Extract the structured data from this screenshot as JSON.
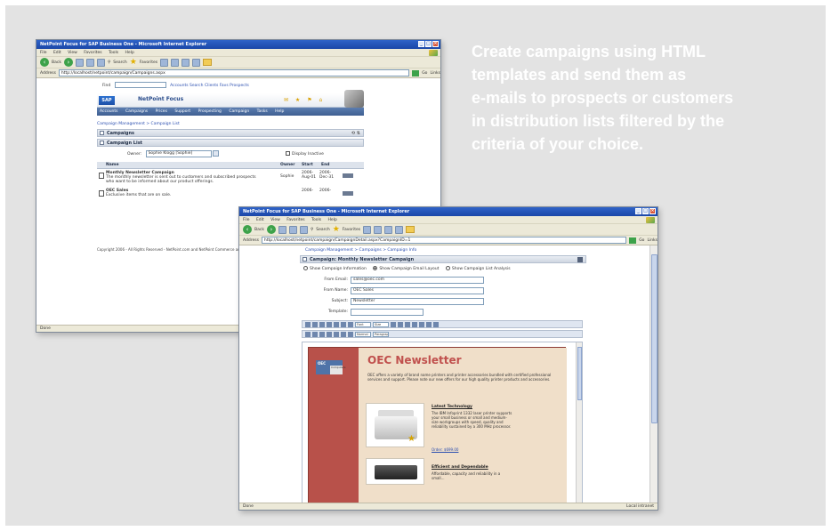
{
  "caption": {
    "lines": [
      "Create campaigns using HTML",
      "templates and send them as",
      "e-mails to prospects or customers",
      "in distribution lists filtered by the",
      "criteria of your choice."
    ]
  },
  "window1": {
    "title": "NetPoint Focus for SAP Business One - Microsoft Internet Explorer",
    "menu": [
      "File",
      "Edit",
      "View",
      "Favorites",
      "Tools",
      "Help"
    ],
    "toolbar": {
      "back": "Back",
      "search": "Search",
      "favorites": "Favorites"
    },
    "address_label": "Address",
    "address": "http://localhost/netpoint/campaign/Campaigns.aspx",
    "go": "Go",
    "links": "Links",
    "search_label": "Find",
    "search_links": "Accounts  Search  Clients  Favs  Prospects",
    "app_name": "NetPoint Focus",
    "nav": [
      "Accounts",
      "Campaigns",
      "Prices",
      "Support",
      "Prospecting",
      "Campaign",
      "Tasks",
      "Help"
    ],
    "breadcrumb": "Campaign Management > Campaign List",
    "section_campaigns": "Campaigns",
    "section_list": "Campaign List",
    "owner_label": "Owner:",
    "owner_value": "Sophie Klogg [Sophie]",
    "display_inactive": "Display Inactive",
    "columns": [
      "Name",
      "Owner",
      "Start",
      "End"
    ],
    "rows": [
      {
        "name": "Monthly Newsletter Campaign",
        "desc": "The monthly newsletter is sent out to customers and subscribed prospects who want to be informed about our product offerings.",
        "owner": "Sophie",
        "start": "2006-Aug-01",
        "end": "2006-Dec-31"
      },
      {
        "name": "OEC Sales",
        "desc": "Exclusive items that are on sale.",
        "owner": "",
        "start": "2006-",
        "end": "2006-"
      }
    ],
    "copyright": "Copyright 2006 - All Rights Reserved - NetPoint.com and NetPoint Commerce and are trademarks",
    "status": "Done",
    "zone": "Local intranet"
  },
  "window2": {
    "title": "NetPoint Focus for SAP Business One - Microsoft Internet Explorer",
    "menu": [
      "File",
      "Edit",
      "View",
      "Favorites",
      "Tools",
      "Help"
    ],
    "toolbar": {
      "back": "Back",
      "search": "Search",
      "favorites": "Favorites"
    },
    "address_label": "Address",
    "address": "http://localhost/netpoint/campaign/CampaignDetail.aspx?CampaignID=1",
    "go": "Go",
    "links": "Links",
    "breadcrumb": "Campaign Management > Campaigns > Campaign Info",
    "section_title": "Campaign: Monthly Newsletter Campaign",
    "radio_options": [
      "Show Campaign Information",
      "Show Campaign Email Layout",
      "Show Campaign List Analysis"
    ],
    "selected_radio": 1,
    "fields": {
      "from_email_label": "From Email:",
      "from_email": "sales@oec.com",
      "from_name_label": "From Name:",
      "from_name": "OEC Sales",
      "subject_label": "Subject:",
      "subject": "Newsletter",
      "template_label": "Template:",
      "template": ""
    },
    "editor_fonts": {
      "font_family": "Font",
      "font_size": "Size",
      "style": "Normal",
      "paragraph": "Paragraph"
    },
    "newsletter": {
      "logo": "OEC",
      "logo_sub": "Computers",
      "title": "OEC Newsletter",
      "intro": "OEC offers a variety of brand name printers and printer accessories bundled with certified professional services and support. Please note our new offers for our high quality printer products and accessories.",
      "item1_title": "Latest Technology",
      "item1_text": "The IBM Infoprint 1332 laser printer supports your small business or small and medium-size workgroups with speed, quality and reliability sustained by a 300 MHz processor.",
      "item1_link": "Order: $699.00",
      "item2_title": "Efficient and Dependable",
      "item2_text": "Affordable, capacity and reliability in a small..."
    },
    "status": "Done",
    "zone": "Local intranet"
  }
}
